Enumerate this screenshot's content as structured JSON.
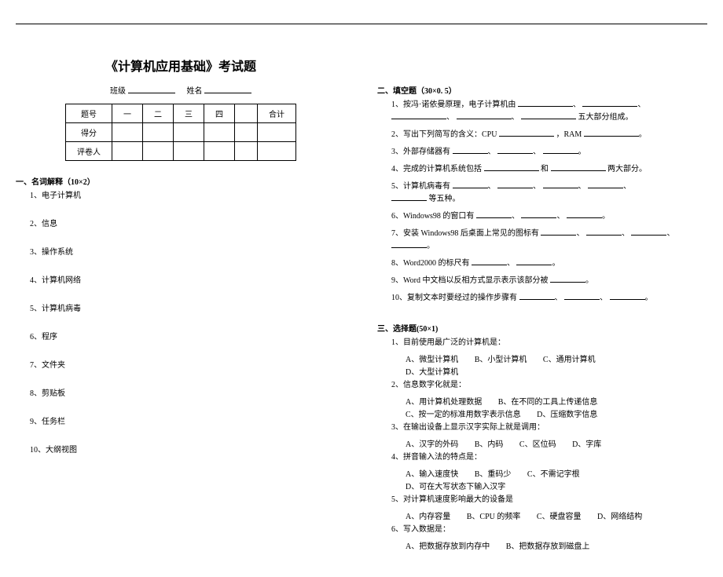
{
  "title": "《计算机应用基础》考试题",
  "header": {
    "class_label": "班级",
    "name_label": "姓名"
  },
  "score_table": {
    "headers": [
      "题号",
      "一",
      "二",
      "三",
      "四",
      "",
      "合计"
    ],
    "rows": [
      "得分",
      "评卷人"
    ]
  },
  "section1": {
    "heading": "一、名词解释（10×2）",
    "items": [
      "1、电子计算机",
      "2、信息",
      "3、操作系统",
      "4、计算机网络",
      "5、计算机病毒",
      "6、程序",
      "7、文件夹",
      "8、剪贴板",
      "9、任务栏",
      "10、大纲视图"
    ]
  },
  "section2": {
    "heading": "二、填空题（30×0. 5）",
    "q1a": "1、按冯·诺依曼原理，电子计算机由",
    "q1b": "五大部分组成。",
    "q2a": "2、写出下列简写的含义：CPU",
    "q2b": "，RAM",
    "q3": "3、外部存储器有",
    "q4a": "4、完成的计算机系统包括",
    "q4b": "和",
    "q4c": "两大部分。",
    "q5a": "5、计算机病毒有",
    "q5b": "等五种。",
    "q6": "6、Windows98 的窗口有",
    "q7": "7、安装 Windows98 后桌面上常见的图标有",
    "q8": "8、Word2000 的标尺有",
    "q9": "9、Word 中文档以反相方式显示表示该部分被",
    "q10": "10、复制文本时要经过的操作步骤有"
  },
  "section3": {
    "heading": "三、选择题(50×1)",
    "q1": {
      "stem": "1、目前使用最广泛的计算机是：",
      "a": "A、微型计算机",
      "b": "B、小型计算机",
      "c": "C、通用计算机",
      "d": "D、大型计算机"
    },
    "q2": {
      "stem": "2、信息数字化就是：",
      "a": "A、用计算机处理数据",
      "b": "B、在不同的工具上传递信息",
      "c": "C、按一定的标准用数字表示信息",
      "d": "D、压缩数字信息"
    },
    "q3": {
      "stem": "3、在输出设备上显示汉字实际上就是调用：",
      "a": "A、汉字的外码",
      "b": "B、内码",
      "c": "C、区位码",
      "d": "D、字库"
    },
    "q4": {
      "stem": "4、拼音输入法的特点是：",
      "a": "A、输入速度快",
      "b": "B、重码少",
      "c": "C、不需记字根",
      "d": "D、可在大写状态下输入汉字"
    },
    "q5": {
      "stem": "5、对计算机速度影响最大的设备是",
      "a": "A、内存容量",
      "b": "B、CPU 的频率",
      "c": "C、硬盘容量",
      "d": "D、网络结构"
    },
    "q6": {
      "stem": "6、写入数据是：",
      "a": "A、把数据存放到内存中",
      "b": "B、把数据存放到磁盘上"
    }
  }
}
